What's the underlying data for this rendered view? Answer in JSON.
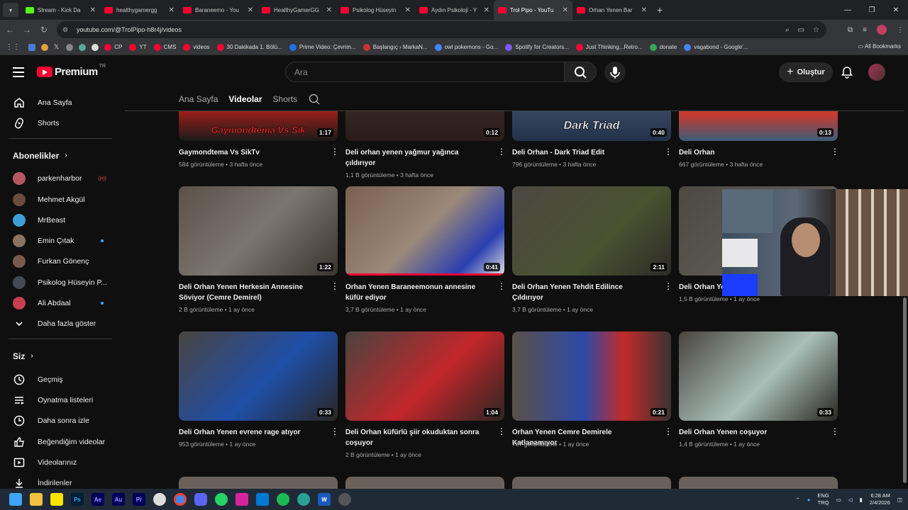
{
  "browser": {
    "tabs": [
      {
        "label": "Stream - Kick Da",
        "fav": "kick"
      },
      {
        "label": "healthygamergg",
        "fav": "yt"
      },
      {
        "label": "Baraneemo - You",
        "fav": "yt"
      },
      {
        "label": "HealthyGamerGG",
        "fav": "yt"
      },
      {
        "label": "Psikolog Hüseyin",
        "fav": "yt"
      },
      {
        "label": "Aydın Psikoloji - Y",
        "fav": "yt"
      },
      {
        "label": "Trol Pipo - YouTu",
        "fav": "yt",
        "active": true
      },
      {
        "label": "Orhan Yenen Bar",
        "fav": "yt"
      }
    ],
    "url": "youtube.com/@TrolPipo-h8r4j/videos",
    "bookmarks": [
      "CP",
      "YT",
      "CMS",
      "videos",
      "30 Dakikada 1. Bölü...",
      "Prime Video: Çevrim...",
      "Başlangıç › MarkaN...",
      "owl pokemons - Go...",
      "Spotify for Creators...",
      "Just Thinking...Retro...",
      "donate",
      "vagabond - Google'..."
    ],
    "all_bookmarks": "All Bookmarks"
  },
  "header": {
    "logo": "Premium",
    "region": "TR",
    "search_placeholder": "Ara",
    "create_label": "Oluştur"
  },
  "sidebar": {
    "main": [
      {
        "label": "Ana Sayfa",
        "icon": "home-icon"
      },
      {
        "label": "Shorts",
        "icon": "shorts-icon"
      }
    ],
    "subscriptions_title": "Abonelikler",
    "subscriptions": [
      {
        "label": "parkenharbor",
        "color": "#b5585f",
        "live": true
      },
      {
        "label": "Mehmet Akgül",
        "color": "#6b4b3a"
      },
      {
        "label": "MrBeast",
        "color": "#3d9fd8"
      },
      {
        "label": "Emin Çıtak",
        "color": "#8a7360",
        "dot": true
      },
      {
        "label": "Furkan Gönenç",
        "color": "#7a5a4a"
      },
      {
        "label": "Psikolog Hüseyin P...",
        "color": "#444a55"
      },
      {
        "label": "Ali Abdaal",
        "color": "#c84050",
        "dot": true
      }
    ],
    "show_more": "Daha fazla göster",
    "you_title": "Siz",
    "you_items": [
      {
        "label": "Geçmiş",
        "icon": "history-icon"
      },
      {
        "label": "Oynatma listeleri",
        "icon": "playlists-icon"
      },
      {
        "label": "Daha sonra izle",
        "icon": "watch-later-icon"
      },
      {
        "label": "Beğendiğim videolar",
        "icon": "liked-icon"
      },
      {
        "label": "Videolarınız",
        "icon": "your-videos-icon"
      },
      {
        "label": "İndirilenler",
        "icon": "downloads-icon"
      }
    ]
  },
  "channel_tabs": [
    "Ana Sayfa",
    "Videolar",
    "Shorts"
  ],
  "videos": [
    {
      "title": "Gaymondtema Vs SikTv",
      "views": "584 görüntüleme",
      "age": "3 hafta önce",
      "duration": "1:17",
      "thumb_text": "Gaymondtema  Vs  Sik"
    },
    {
      "title": "Deli orhan yenen yağmur yağınca çıldırıyor",
      "views": "1,1 B görüntüleme",
      "age": "3 hafta önce",
      "duration": "0:12"
    },
    {
      "title": "Deli Orhan - Dark Triad Edit",
      "views": "796 görüntüleme",
      "age": "3 hafta önce",
      "duration": "0:40",
      "thumb_text": "Dark Triad"
    },
    {
      "title": "Deli Orhan",
      "views": "667 görüntüleme",
      "age": "3 hafta önce",
      "duration": "0:13"
    },
    {
      "title": "Deli Orhan Yenen Herkesin Annesine Söviyor (Cemre Demirel)",
      "views": "2 B görüntüleme",
      "age": "1 ay önce",
      "duration": "1:22"
    },
    {
      "title": "Orhan Yenen Baraneemonun annesine küfür ediyor",
      "views": "3,7 B görüntüleme",
      "age": "1 ay önce",
      "duration": "0:41"
    },
    {
      "title": "Deli Orhan Yenen Tehdit Edilince Çıldırıyor",
      "views": "3,7 B görüntüleme",
      "age": "1 ay önce",
      "duration": "2:11"
    },
    {
      "title": "Deli Orhan Ye",
      "views": "1,5 B görüntüleme",
      "age": "1 ay önce",
      "duration": ""
    },
    {
      "title": "Deli Orhan Yenen evrene rage atıyor",
      "views": "953 görüntüleme",
      "age": "1 ay önce",
      "duration": "0:33"
    },
    {
      "title": "Deli Orhan küfürlü şiir okuduktan sonra coşuyor",
      "views": "2 B görüntüleme",
      "age": "1 ay önce",
      "duration": "1:04"
    },
    {
      "title": "Orhan Yenen Cemre Demirele Katlanamıyor",
      "views": "787 görüntüleme",
      "age": "1 ay önce",
      "duration": "0:21"
    },
    {
      "title": "Deli Orhan Yenen coşuyor",
      "views": "1,4 B görüntüleme",
      "age": "1 ay önce",
      "duration": "0:33"
    }
  ],
  "taskbar": {
    "lang": "ENG",
    "lang2": "TRQ",
    "time": "6:28 AM",
    "date": "2/4/2026"
  }
}
